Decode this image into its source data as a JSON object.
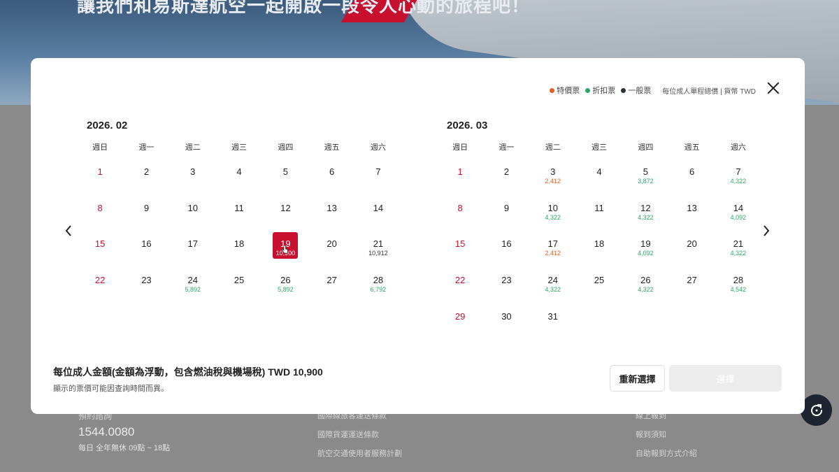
{
  "background": {
    "hero_text": "讓我們和易斯達航空一起開啟一段令人心動的旅程吧！",
    "phone": "1544.0080",
    "phone_label": "預約諮詢",
    "hours": "每日 全年無休 09點 ~ 18點",
    "links_col1": [
      "國際線旅客運送條款",
      "國際貨運運送條款",
      "航空交通使用者服務計劃"
    ],
    "links_col2": [
      "線上報到",
      "報到須知",
      "自助報到方式介紹"
    ]
  },
  "legend": {
    "special": "特價票",
    "discount": "折扣票",
    "regular": "一般票",
    "note": "每位成人單程總價 | 貨幣 TWD",
    "colors": {
      "special": "#e0602a",
      "discount": "#2aa866",
      "regular": "#2a2f3a"
    }
  },
  "weekdays": [
    "週日",
    "週一",
    "週二",
    "週三",
    "週四",
    "週五",
    "週六"
  ],
  "months": [
    {
      "title": "2026. 02",
      "start_offset": 0,
      "days": [
        {
          "d": "1"
        },
        {
          "d": "2"
        },
        {
          "d": "3"
        },
        {
          "d": "4"
        },
        {
          "d": "5"
        },
        {
          "d": "6"
        },
        {
          "d": "7"
        },
        {
          "d": "8"
        },
        {
          "d": "9"
        },
        {
          "d": "10"
        },
        {
          "d": "11"
        },
        {
          "d": "12"
        },
        {
          "d": "13"
        },
        {
          "d": "14"
        },
        {
          "d": "15"
        },
        {
          "d": "16"
        },
        {
          "d": "17"
        },
        {
          "d": "18"
        },
        {
          "d": "19",
          "p": "10,900",
          "t": "regular",
          "selected": true
        },
        {
          "d": "20"
        },
        {
          "d": "21",
          "p": "10,912",
          "t": "regular"
        },
        {
          "d": "22"
        },
        {
          "d": "23"
        },
        {
          "d": "24",
          "p": "5,892",
          "t": "discount"
        },
        {
          "d": "25"
        },
        {
          "d": "26",
          "p": "5,892",
          "t": "discount"
        },
        {
          "d": "27"
        },
        {
          "d": "28",
          "p": "6,792",
          "t": "discount"
        }
      ]
    },
    {
      "title": "2026. 03",
      "start_offset": 0,
      "days": [
        {
          "d": "1"
        },
        {
          "d": "2"
        },
        {
          "d": "3",
          "p": "2,412",
          "t": "special"
        },
        {
          "d": "4"
        },
        {
          "d": "5",
          "p": "3,872",
          "t": "discount"
        },
        {
          "d": "6"
        },
        {
          "d": "7",
          "p": "4,322",
          "t": "discount"
        },
        {
          "d": "8"
        },
        {
          "d": "9"
        },
        {
          "d": "10",
          "p": "4,322",
          "t": "discount"
        },
        {
          "d": "11"
        },
        {
          "d": "12",
          "p": "4,322",
          "t": "discount"
        },
        {
          "d": "13"
        },
        {
          "d": "14",
          "p": "4,092",
          "t": "discount"
        },
        {
          "d": "15"
        },
        {
          "d": "16"
        },
        {
          "d": "17",
          "p": "2,412",
          "t": "special"
        },
        {
          "d": "18"
        },
        {
          "d": "19",
          "p": "4,092",
          "t": "discount"
        },
        {
          "d": "20"
        },
        {
          "d": "21",
          "p": "4,322",
          "t": "discount"
        },
        {
          "d": "22"
        },
        {
          "d": "23"
        },
        {
          "d": "24",
          "p": "4,322",
          "t": "discount"
        },
        {
          "d": "25"
        },
        {
          "d": "26",
          "p": "4,322",
          "t": "discount"
        },
        {
          "d": "27"
        },
        {
          "d": "28",
          "p": "4,542",
          "t": "discount"
        },
        {
          "d": "29"
        },
        {
          "d": "30"
        },
        {
          "d": "31"
        }
      ]
    }
  ],
  "footer": {
    "total_text": "每位成人金額(金額為浮動，包含燃油稅與機場稅) TWD 10,900",
    "disclaimer": "顯示的票價可能因查詢時間而異。"
  },
  "buttons": {
    "reset": "重新選擇",
    "select": "選擇"
  }
}
